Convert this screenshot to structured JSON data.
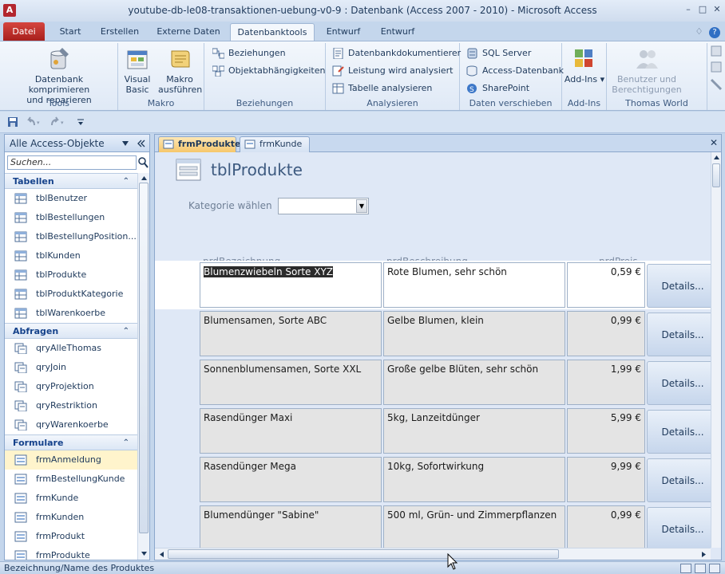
{
  "window": {
    "title": "youtube-db-le08-transaktionen-uebung-v0-9 : Datenbank (Access 2007 - 2010)  -  Microsoft Access",
    "app_icon": "A",
    "minimize": "–",
    "maximize": "□",
    "close": "✕"
  },
  "ribbon_tabs": {
    "file": "Datei",
    "tabs": [
      "Start",
      "Erstellen",
      "Externe Daten",
      "Datenbanktools",
      "Entwurf",
      "Entwurf"
    ],
    "active_index": 3,
    "minimize_ribbon": "♢",
    "help": "?"
  },
  "ribbon": {
    "tools": {
      "compact_label_1": "Datenbank komprimieren",
      "compact_label_2": "und reparieren",
      "group": "Tools"
    },
    "makro": {
      "vb_1": "Visual",
      "vb_2": "Basic",
      "run_1": "Makro",
      "run_2": "ausführen",
      "group": "Makro"
    },
    "beziehungen": {
      "rel": "Beziehungen",
      "dep": "Objektabhängigkeiten",
      "group": "Beziehungen"
    },
    "analysieren": {
      "doc": "Datenbankdokumentierer",
      "perf": "Leistung wird analysiert",
      "table": "Tabelle analysieren",
      "group": "Analysieren"
    },
    "verschieben": {
      "sql": "SQL Server",
      "accdb": "Access-Datenbank",
      "sp": "SharePoint",
      "group": "Daten verschieben"
    },
    "addins": {
      "label": "Add-Ins",
      "group": "Add-Ins"
    },
    "thomas": {
      "users_1": "Benutzer und",
      "users_2": "Berechtigungen",
      "group": "Thomas World"
    }
  },
  "nav": {
    "title": "Alle Access-Objekte",
    "search_placeholder": "Suchen...",
    "sections": [
      {
        "title": "Tabellen",
        "items": [
          "tblBenutzer",
          "tblBestellungen",
          "tblBestellungPosition...",
          "tblKunden",
          "tblProdukte",
          "tblProduktKategorie",
          "tblWarenkoerbe"
        ]
      },
      {
        "title": "Abfragen",
        "items": [
          "qryAlleThomas",
          "qryJoin",
          "qryProjektion",
          "qryRestriktion",
          "qryWarenkoerbe"
        ]
      },
      {
        "title": "Formulare",
        "items": [
          "frmAnmeldung",
          "frmBestellungKunde",
          "frmKunde",
          "frmKunden",
          "frmProdukt",
          "frmProdukte"
        ]
      }
    ]
  },
  "doc_tabs": [
    "frmProdukte",
    "frmKunde"
  ],
  "form": {
    "title": "tblProdukte",
    "category_label": "Kategorie wählen",
    "columns": [
      "prdBezeichnung",
      "prdBeschreibung",
      "prdPreis"
    ],
    "details_label": "Details...",
    "rows": [
      {
        "name": "Blumenzwiebeln Sorte XYZ",
        "desc": "Rote Blumen, sehr schön",
        "price": "0,59 €"
      },
      {
        "name": "Blumensamen, Sorte ABC",
        "desc": "Gelbe Blumen, klein",
        "price": "0,99 €"
      },
      {
        "name": "Sonnenblumensamen, Sorte XXL",
        "desc": "Große gelbe Blüten, sehr schön",
        "price": "1,99 €"
      },
      {
        "name": "Rasendünger Maxi",
        "desc": "5kg, Lanzeitdünger",
        "price": "5,99 €"
      },
      {
        "name": "Rasendünger Mega",
        "desc": "10kg, Sofortwirkung",
        "price": "9,99 €"
      },
      {
        "name": "Blumendünger \"Sabine\"",
        "desc": "500 ml, Grün- und Zimmerpflanzen",
        "price": "0,99 €"
      }
    ]
  },
  "status": {
    "text": "Bezeichnung/Name des Produktes"
  },
  "colors": {
    "file_tab": "#b3262e",
    "active_doc_tab": "#f6c76b",
    "selection": "#2b2b2b"
  }
}
